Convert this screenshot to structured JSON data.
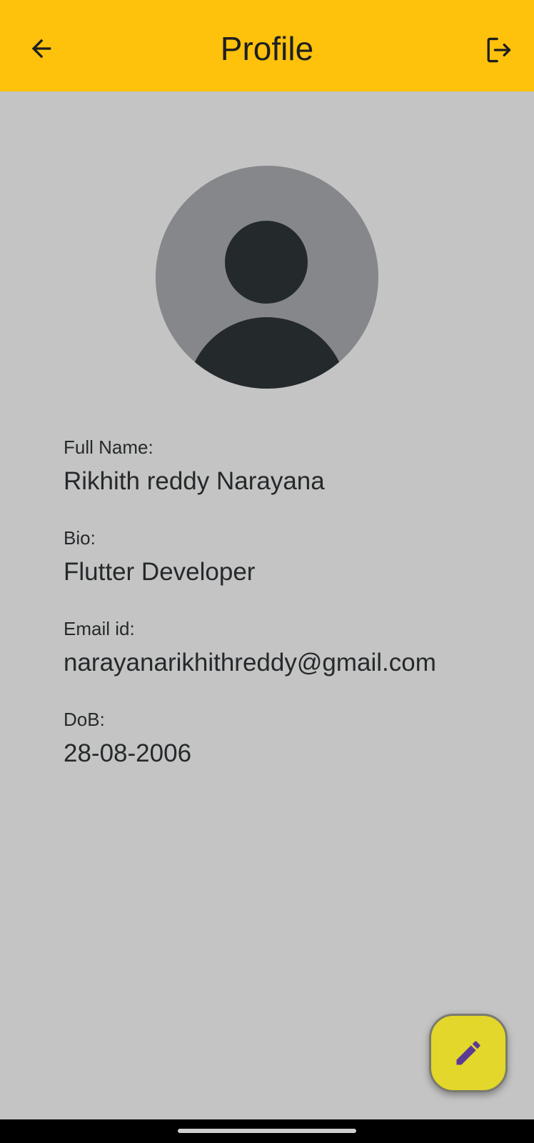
{
  "app_bar": {
    "title": "Profile",
    "back_icon": "arrow-left-icon",
    "logout_icon": "logout-icon",
    "background_color": "#fec20c"
  },
  "avatar": {
    "icon": "person-avatar-icon"
  },
  "profile": {
    "full_name_label": "Full Name:",
    "full_name": "Rikhith reddy Narayana",
    "bio_label": "Bio:",
    "bio": "Flutter Developer",
    "email_label": "Email id:",
    "email": "narayanarikhithreddy@gmail.com",
    "dob_label": "DoB:",
    "dob": "28-08-2006"
  },
  "fab": {
    "icon": "pencil-edit-icon",
    "background_color": "#e2d72a",
    "icon_color": "#5b3a96"
  }
}
